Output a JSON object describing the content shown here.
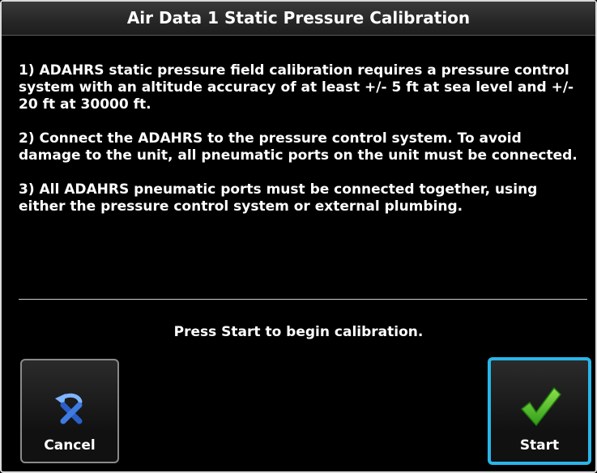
{
  "dialog": {
    "title": "Air Data 1 Static Pressure Calibration",
    "instructions": [
      "1) ADAHRS static pressure field calibration requires a pressure control system with an altitude accuracy of at least +/- 5 ft at sea level and +/- 20 ft at 30000 ft.",
      "2) Connect the ADAHRS to the pressure control system. To avoid damage to the unit, all pneumatic ports on the unit must be connected.",
      "3) All ADAHRS pneumatic ports must be connected together, using either the pressure control system or external plumbing."
    ],
    "prompt": "Press Start to begin calibration."
  },
  "buttons": {
    "cancel": {
      "label": "Cancel",
      "icon": "undo-cancel-icon"
    },
    "start": {
      "label": "Start",
      "icon": "checkmark-icon",
      "highlight_color": "#29b6e8"
    }
  },
  "colors": {
    "background": "#000000",
    "text": "#ffffff",
    "check": "#3fbf1f",
    "cancel_icon": "#2a6fd6"
  }
}
